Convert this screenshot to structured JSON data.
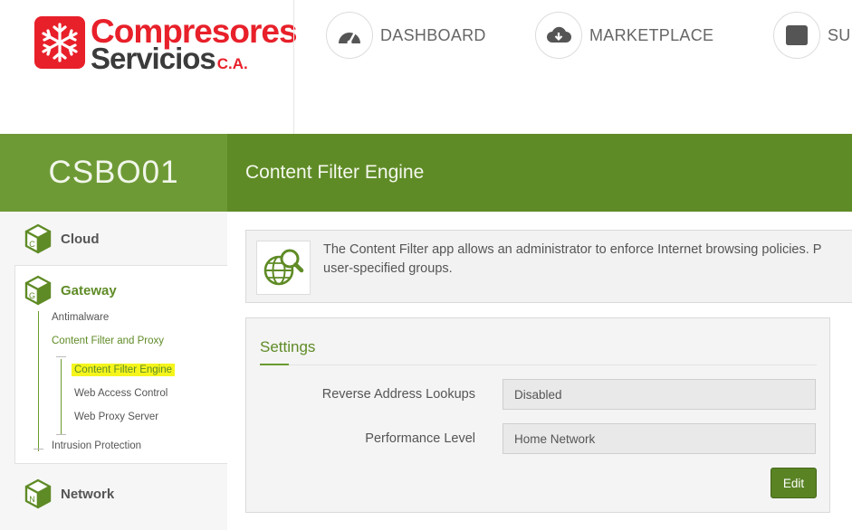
{
  "brand": {
    "line1": "Compresores",
    "line2": "Servicios",
    "suffix": "C.A.",
    "red": "#e8202a"
  },
  "topnav": [
    {
      "label": "DASHBOARD",
      "icon": "gauge-icon"
    },
    {
      "label": "MARKETPLACE",
      "icon": "cloud-download-icon"
    },
    {
      "label": "SUP",
      "icon": "inbox-icon"
    }
  ],
  "header": {
    "hostname": "CSBO01",
    "page_title": "Content Filter Engine",
    "accent": "#5f8b26"
  },
  "sidebar": {
    "cloud": {
      "label": "Cloud",
      "letter": "C"
    },
    "gateway": {
      "label": "Gateway",
      "letter": "G",
      "items": {
        "antimalware": "Antimalware",
        "content_filter_proxy": "Content Filter and Proxy",
        "content_filter_engine": "Content Filter Engine",
        "web_access_control": "Web Access Control",
        "web_proxy_server": "Web Proxy Server",
        "intrusion_protection": "Intrusion Protection"
      }
    },
    "network": {
      "label": "Network",
      "letter": "N"
    }
  },
  "info": {
    "icon": "globe-search-icon",
    "line1": "The Content Filter app allows an administrator to enforce Internet browsing policies. P",
    "line2": "user-specified groups."
  },
  "settings": {
    "title": "Settings",
    "reverse_lookups_label": "Reverse Address Lookups",
    "reverse_lookups_value": "Disabled",
    "performance_label": "Performance Level",
    "performance_value": "Home Network",
    "edit_label": "Edit"
  }
}
